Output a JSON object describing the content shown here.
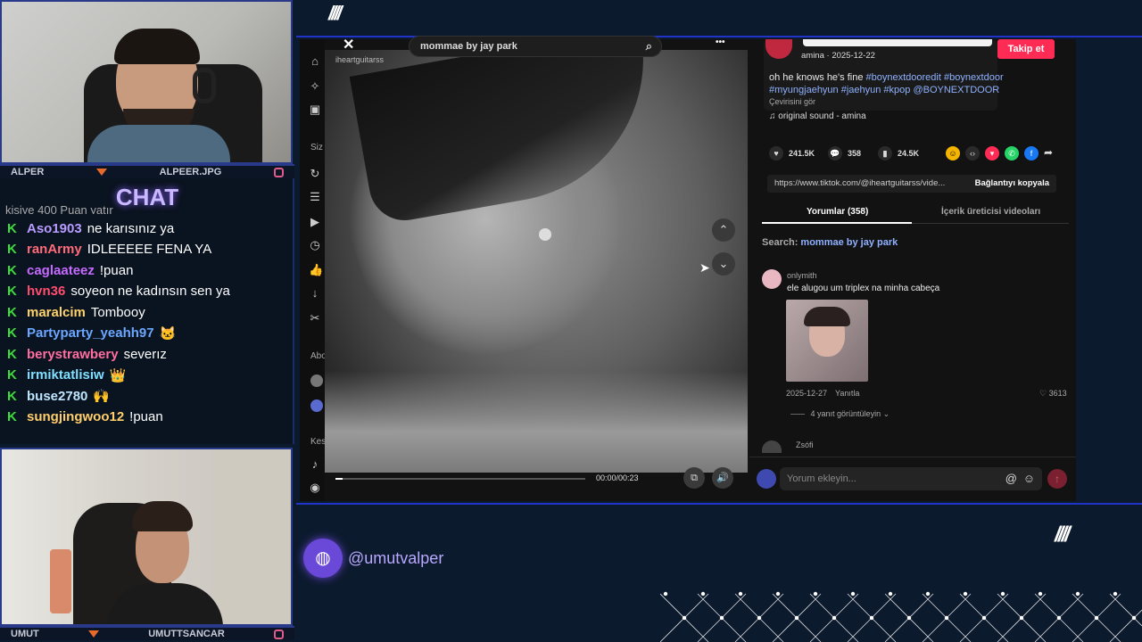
{
  "overlay": {
    "slashes_top": "////",
    "slashes_right": "////",
    "handle": "@umutvalper",
    "accent_color": "#2233c8"
  },
  "cam_top": {
    "left_name": "ALPER",
    "right_name": "ALPEER.JPG"
  },
  "cam_bottom": {
    "left_name": "UMUT",
    "right_name": "UMUTTSANCAR"
  },
  "chat": {
    "title": "CHAT",
    "partial_top": "kişiye 400 Puan yatır",
    "messages": [
      {
        "user": "Aso1903",
        "color": "#b99cff",
        "text": "ne karısınız ya"
      },
      {
        "user": "ranArmy",
        "color": "#ff6b7a",
        "text": "IDLEEEEE FENA YA"
      },
      {
        "user": "caglaateez",
        "color": "#c66bff",
        "text": "!puan"
      },
      {
        "user": "hvn36",
        "color": "#ff4d6d",
        "text": "soyeon ne kadınsın sen ya"
      },
      {
        "user": "maralcim",
        "color": "#ffd36b",
        "text": "Tombooy"
      },
      {
        "user": "Partyparty_yeahh97",
        "color": "#6ba7ff",
        "text": "🐱"
      },
      {
        "user": "berystrawbery",
        "color": "#ff6fa0",
        "text": "severız"
      },
      {
        "user": "irmiktatlisiw",
        "color": "#7fe0ff",
        "text": "👑"
      },
      {
        "user": "buse2780",
        "color": "#bfe6ff",
        "text": "🙌"
      },
      {
        "user": "sungjingwoo12",
        "color": "#ffcf6b",
        "text": "!puan"
      }
    ]
  },
  "browser": {
    "search_query": "mommae by jay park",
    "watermark": "iheartguitarss",
    "close_label": "✕",
    "more_label": "•••",
    "time": "00:00/00:23",
    "sidebar": {
      "label_siz": "Siz",
      "label_abo": "Abo",
      "label_kes": "Kes"
    },
    "post": {
      "author_line": "amina · 2025-12-22",
      "follow_label": "Takip et",
      "caption_plain": "oh he knows he's fine",
      "caption_tags_1": "#boynextdooredit #boynextdoor",
      "caption_tags_2": "#myungjaehyun #jaehyun #kpop @BOYNEXTDOOR",
      "translate_label": "Çevirisini gör",
      "sound": "original sound - amina",
      "likes": "241.5K",
      "comments": "358",
      "saves": "24.5K",
      "link": "https://www.tiktok.com/@iheartguitarss/vide...",
      "copy_label": "Bağlantıyı kopyala"
    },
    "tabs": {
      "comments": "Yorumlar (358)",
      "creator_videos": "İçerik üreticisi videoları"
    },
    "search_hint_prefix": "Search:",
    "search_hint_query": "mommae by jay park",
    "comment": {
      "user": "onlymith",
      "text": "ele alugou um triplex na minha cabeça",
      "date": "2025-12-27",
      "reply_label": "Yanıtla",
      "likes": "3613",
      "view_replies": "4 yanıt görüntüleyin"
    },
    "next_comment_user": "Zsófi",
    "comment_placeholder": "Yorum ekleyin..."
  }
}
